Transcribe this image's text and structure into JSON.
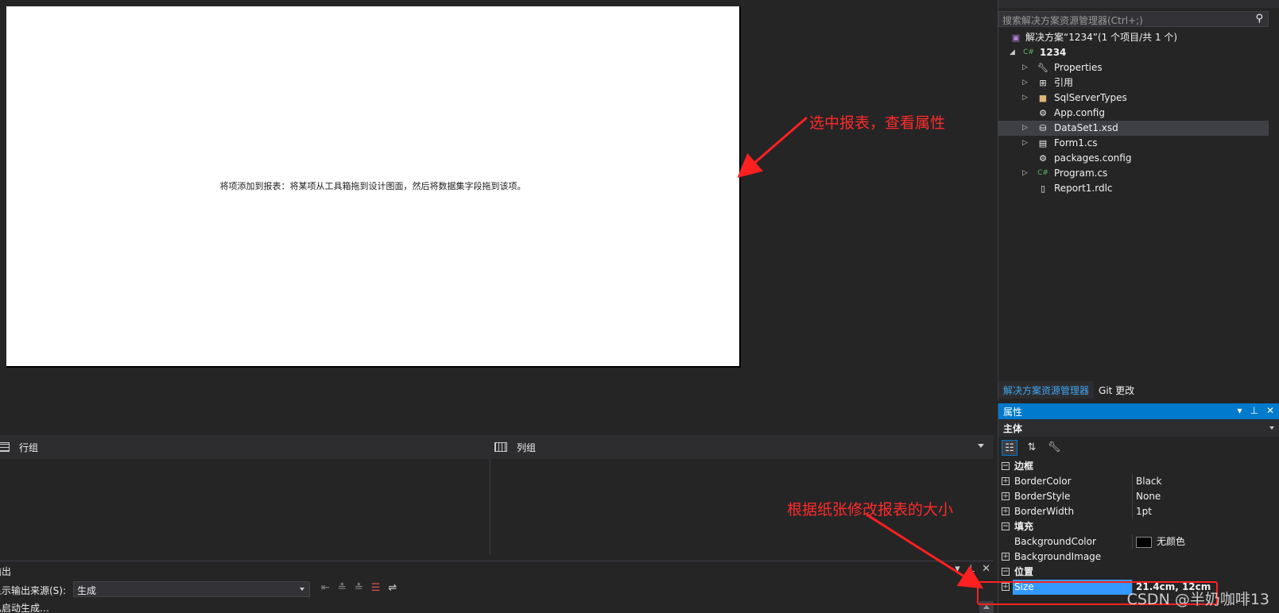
{
  "designer": {
    "hint": "将项添加到报表：将某项从工具箱拖到设计图面，然后将数据集字段拖到该项。"
  },
  "grouping": {
    "row_label": "行组",
    "col_label": "列组"
  },
  "output": {
    "title": "输出",
    "source_label": "显示输出来源(S):",
    "source_value": "生成",
    "line1": "已启动生成…"
  },
  "solution_explorer": {
    "search_placeholder": "搜索解决方案资源管理器(Ctrl+;)",
    "solution": "解决方案“1234”(1 个项目/共 1 个)",
    "project": "1234",
    "items": [
      {
        "label": "Properties",
        "icon": "wrench-icon"
      },
      {
        "label": "引用",
        "icon": "references-icon"
      },
      {
        "label": "SqlServerTypes",
        "icon": "folder-icon"
      },
      {
        "label": "App.config",
        "icon": "config-file-icon"
      },
      {
        "label": "DataSet1.xsd",
        "icon": "dataset-icon"
      },
      {
        "label": "Form1.cs",
        "icon": "form-icon"
      },
      {
        "label": "packages.config",
        "icon": "config-file-icon"
      },
      {
        "label": "Program.cs",
        "icon": "csharp-file-icon"
      },
      {
        "label": "Report1.rdlc",
        "icon": "report-file-icon"
      }
    ],
    "tabs": [
      "解决方案资源管理器",
      "Git 更改"
    ]
  },
  "properties": {
    "title": "属性",
    "object": "主体",
    "rows": [
      {
        "name": "边框",
        "category": true
      },
      {
        "name": "BorderColor",
        "value": "Black"
      },
      {
        "name": "BorderStyle",
        "value": "None"
      },
      {
        "name": "BorderWidth",
        "value": "1pt"
      },
      {
        "name": "填充",
        "category": true
      },
      {
        "name": "BackgroundColor",
        "value": "无颜色"
      },
      {
        "name": "BackgroundImage",
        "value": ""
      },
      {
        "name": "位置",
        "category": true
      },
      {
        "name": "Size",
        "value": "21.4cm, 12cm"
      }
    ]
  },
  "annotations": {
    "select_report": "选中报表，查看属性",
    "resize": "根据纸张修改报表的大小"
  },
  "watermark": "CSDN @半奶咖啡13",
  "colors": {
    "accent": "#007acc",
    "annotation": "#ff2a2a",
    "selection": "#3399ff"
  }
}
